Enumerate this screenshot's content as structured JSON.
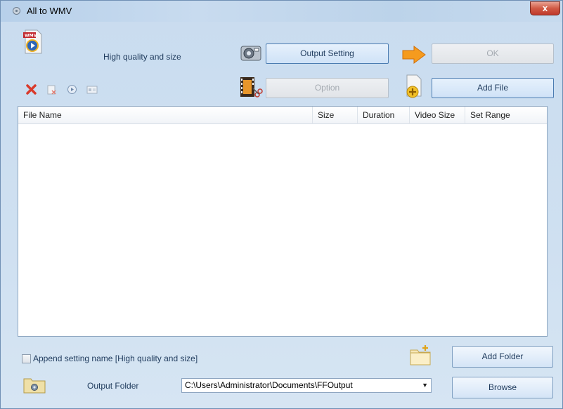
{
  "window": {
    "title": "All to WMV",
    "close_glyph": "x"
  },
  "toolbar": {
    "profile_label": "High quality and size",
    "output_setting_label": "Output Setting",
    "ok_label": "OK",
    "option_label": "Option",
    "add_file_label": "Add File"
  },
  "table": {
    "columns": [
      "File Name",
      "Size",
      "Duration",
      "Video Size",
      "Set Range"
    ]
  },
  "footer": {
    "append_setting_label": "Append setting name [High quality and size]",
    "add_folder_label": "Add Folder",
    "output_folder_label": "Output Folder",
    "output_folder_value": "C:\\Users\\Administrator\\Documents\\FFOutput",
    "browse_label": "Browse"
  },
  "colors": {
    "accent": "#4b7cb1",
    "delete_red": "#d93a2b",
    "arrow_orange": "#f59b1e"
  }
}
